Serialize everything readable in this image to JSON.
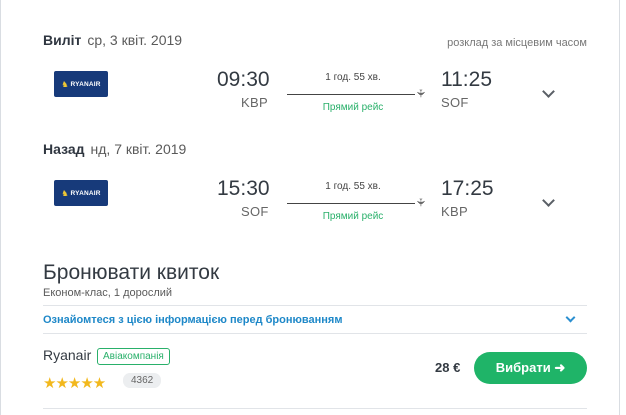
{
  "outbound": {
    "label": "Виліт",
    "date": "ср, 3 квіт. 2019",
    "local_time_note": "розклад за місцевим часом",
    "airline_logo_text": "RYANAIR",
    "dep_time": "09:30",
    "dep_code": "KBP",
    "duration": "1 год. 55 хв.",
    "type": "Прямий рейс",
    "arr_time": "11:25",
    "arr_code": "SOF"
  },
  "inbound": {
    "label": "Назад",
    "date": "нд, 7 квіт. 2019",
    "airline_logo_text": "RYANAIR",
    "dep_time": "15:30",
    "dep_code": "SOF",
    "duration": "1 год. 55 хв.",
    "type": "Прямий рейс",
    "arr_time": "17:25",
    "arr_code": "KBP"
  },
  "booking": {
    "title": "Бронювати квиток",
    "cabin": "Економ-клас, 1 дорослий",
    "info_link": "Ознайомтеся з цією інформацією перед бронюванням",
    "carrier_name": "Ryanair",
    "carrier_badge": "Авіакомпанія",
    "rating_stars": "★★★★★",
    "rating_value": 5,
    "review_count": "4362",
    "price": "28 €",
    "select_button": "Вибрати ➜"
  },
  "colors": {
    "accent_green": "#1fb468",
    "link_blue": "#1e88c8",
    "star_yellow": "#f2b81d",
    "ryanair_navy": "#173a7a"
  },
  "icons": [
    "ryanair-logo",
    "plane-icon",
    "chevron-down-icon",
    "star-icon"
  ]
}
